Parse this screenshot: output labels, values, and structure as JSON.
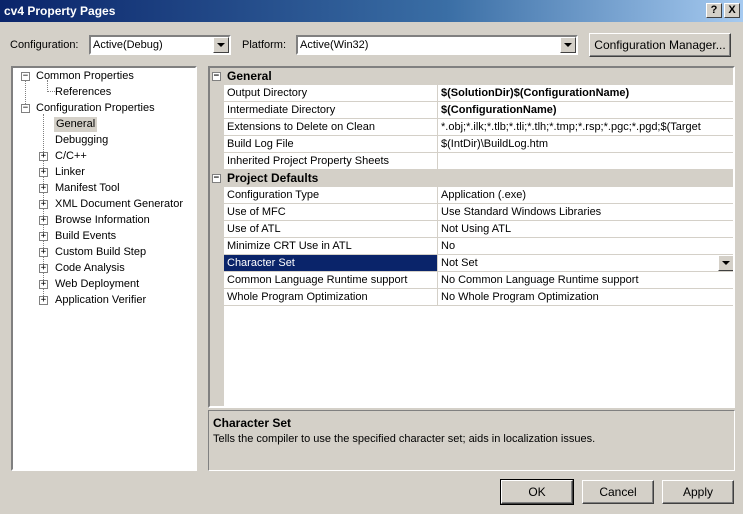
{
  "window": {
    "title": "cv4 Property Pages",
    "help_glyph": "?",
    "close_glyph": "X"
  },
  "config_bar": {
    "configuration_label": "Configuration:",
    "configuration_value": "Active(Debug)",
    "platform_label": "Platform:",
    "platform_value": "Active(Win32)",
    "manager_button": "Configuration Manager..."
  },
  "tree": {
    "common": "Common Properties",
    "references": "References",
    "config": "Configuration Properties",
    "general": "General",
    "debugging": "Debugging",
    "items": [
      "C/C++",
      "Linker",
      "Manifest Tool",
      "XML Document Generator",
      "Browse Information",
      "Build Events",
      "Custom Build Step",
      "Code Analysis",
      "Web Deployment",
      "Application Verifier"
    ]
  },
  "grid": {
    "general_header": "General",
    "general_rows": [
      {
        "name": "Output Directory",
        "value": "$(SolutionDir)$(ConfigurationName)"
      },
      {
        "name": "Intermediate Directory",
        "value": "$(ConfigurationName)"
      },
      {
        "name": "Extensions to Delete on Clean",
        "value": "*.obj;*.ilk;*.tlb;*.tli;*.tlh;*.tmp;*.rsp;*.pgc;*.pgd;$(Target"
      },
      {
        "name": "Build Log File",
        "value": "$(IntDir)\\BuildLog.htm"
      },
      {
        "name": "Inherited Project Property Sheets",
        "value": ""
      }
    ],
    "defaults_header": "Project Defaults",
    "defaults_rows": [
      {
        "name": "Configuration Type",
        "value": "Application (.exe)"
      },
      {
        "name": "Use of MFC",
        "value": "Use Standard Windows Libraries"
      },
      {
        "name": "Use of ATL",
        "value": "Not Using ATL"
      },
      {
        "name": "Minimize CRT Use in ATL",
        "value": "No"
      },
      {
        "name": "Character Set",
        "value": "Not Set"
      },
      {
        "name": "Common Language Runtime support",
        "value": "No Common Language Runtime support"
      },
      {
        "name": "Whole Program Optimization",
        "value": "No Whole Program Optimization"
      }
    ]
  },
  "description": {
    "title": "Character Set",
    "text": "Tells the compiler to use the specified character set; aids in localization issues."
  },
  "buttons": {
    "ok": "OK",
    "cancel": "Cancel",
    "apply": "Apply"
  },
  "colors": {
    "selection": "#0a246a",
    "face": "#d4d0c8"
  },
  "icons": {
    "expand": "plus-box",
    "collapse": "minus-box",
    "dropdown": "triangle-down"
  }
}
